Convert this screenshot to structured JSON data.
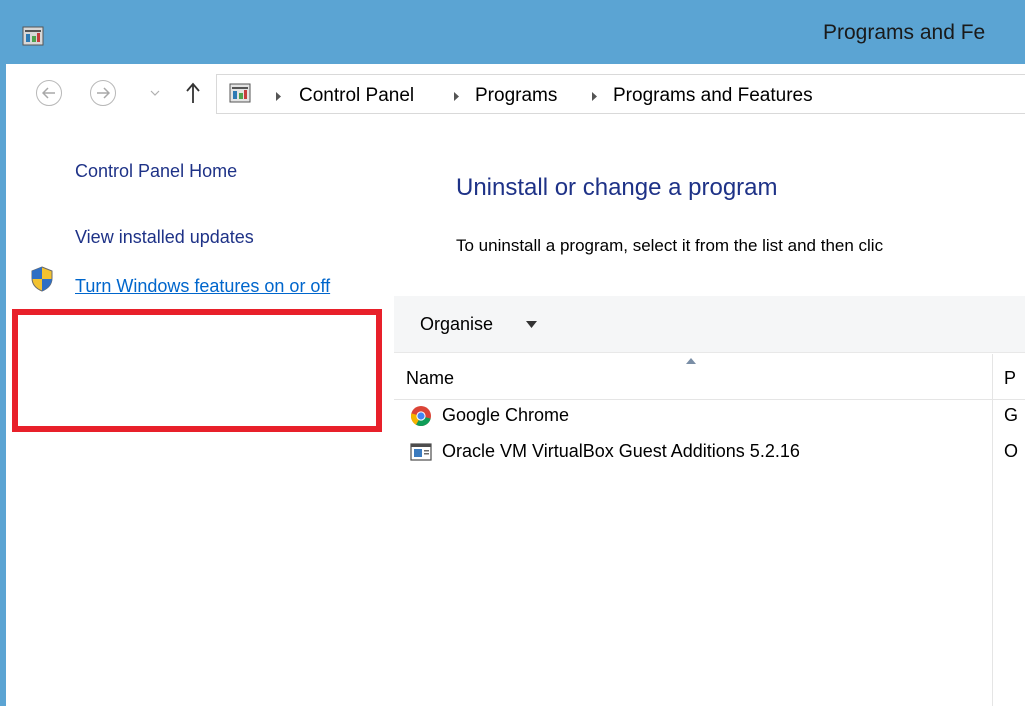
{
  "window": {
    "title": "Programs and Fe"
  },
  "navigation": {
    "breadcrumbs": [
      "Control Panel",
      "Programs",
      "Programs and Features"
    ]
  },
  "left_pane": {
    "home_link": "Control Panel Home",
    "updates_link": "View installed updates",
    "features_link": "Turn Windows features on or off"
  },
  "main": {
    "heading": "Uninstall or change a program",
    "description": "To uninstall a program, select it from the list and then clic",
    "toolbar": {
      "organise_label": "Organise"
    },
    "columns": {
      "name": "Name",
      "publisher": "P"
    },
    "programs": [
      {
        "name": "Google Chrome",
        "publisher": "G",
        "icon": "chrome-icon"
      },
      {
        "name": "Oracle VM VirtualBox Guest Additions 5.2.16",
        "publisher": "O",
        "icon": "installer-icon"
      }
    ]
  },
  "colors": {
    "titlebar": "#5ba4d3",
    "link": "#0066cc",
    "heading": "#1e3287",
    "highlight": "#e8202a"
  }
}
